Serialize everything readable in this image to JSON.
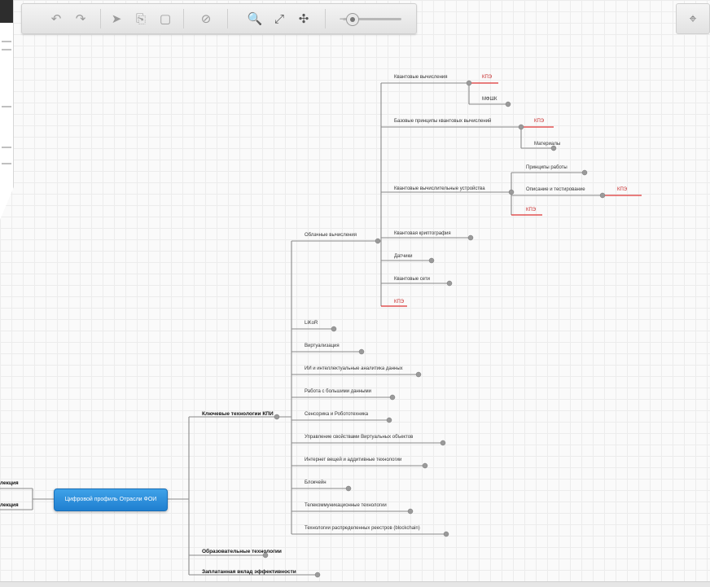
{
  "toolbar": {
    "icons": [
      "undo-icon",
      "redo-icon",
      "cursor-icon",
      "copy-icon",
      "paste-icon",
      "disabled-icon",
      "search-icon",
      "fit-screen-icon",
      "collapse-icon"
    ],
    "undo_glyph": "↶",
    "redo_glyph": "↷",
    "cursor_glyph": "➤",
    "copy_glyph": "⎘",
    "paste_glyph": "▢",
    "disabled_glyph": "⊘",
    "search_glyph": "🔍",
    "fit_glyph": "⤢",
    "collapse_glyph": "✣",
    "zoom_level": 0.1
  },
  "locate": {
    "glyph": "⌖"
  },
  "mindmap": {
    "root": "Цифровой профиль Отрасли ФОИ",
    "left_items": [
      "лекция",
      "лекция"
    ],
    "level1": [
      "Ключевые технологии КПИ",
      "Образовательные технологии",
      "Заплатанная вклад эффективности"
    ],
    "level2": [
      "Облачные вычисления",
      "LiKoR",
      "Виртуализация",
      "ИИ и интеллектуальные аналитика данных",
      "Работа с большими данными",
      "Сенсорика и Робототехника",
      "Управление свойствами Виртуальных объектов",
      "Интернет вещей и аддитивные технологии",
      "Блокчейн",
      "Телекоммуникационные технологии",
      "Технологии распределенных реестров (blockchain)"
    ],
    "level3": [
      "Квантовые вычисления",
      "Базовые принципы квантовых вычислений",
      "Квантовые вычислительные устройства",
      "Квантовая криптография",
      "Датчики",
      "Квантовые сети",
      "КПЭ"
    ],
    "level4": [
      "КПЭ",
      "МФШК",
      "КПЭ",
      "Материалы",
      "Принципы работы",
      "Описание и тестирование",
      "КПЭ",
      "КПЭ"
    ]
  },
  "colors": {
    "root_bg": "#1f7fd0",
    "line": "#8a8a8a",
    "red_line": "#d33",
    "node_dot": "#888888"
  }
}
